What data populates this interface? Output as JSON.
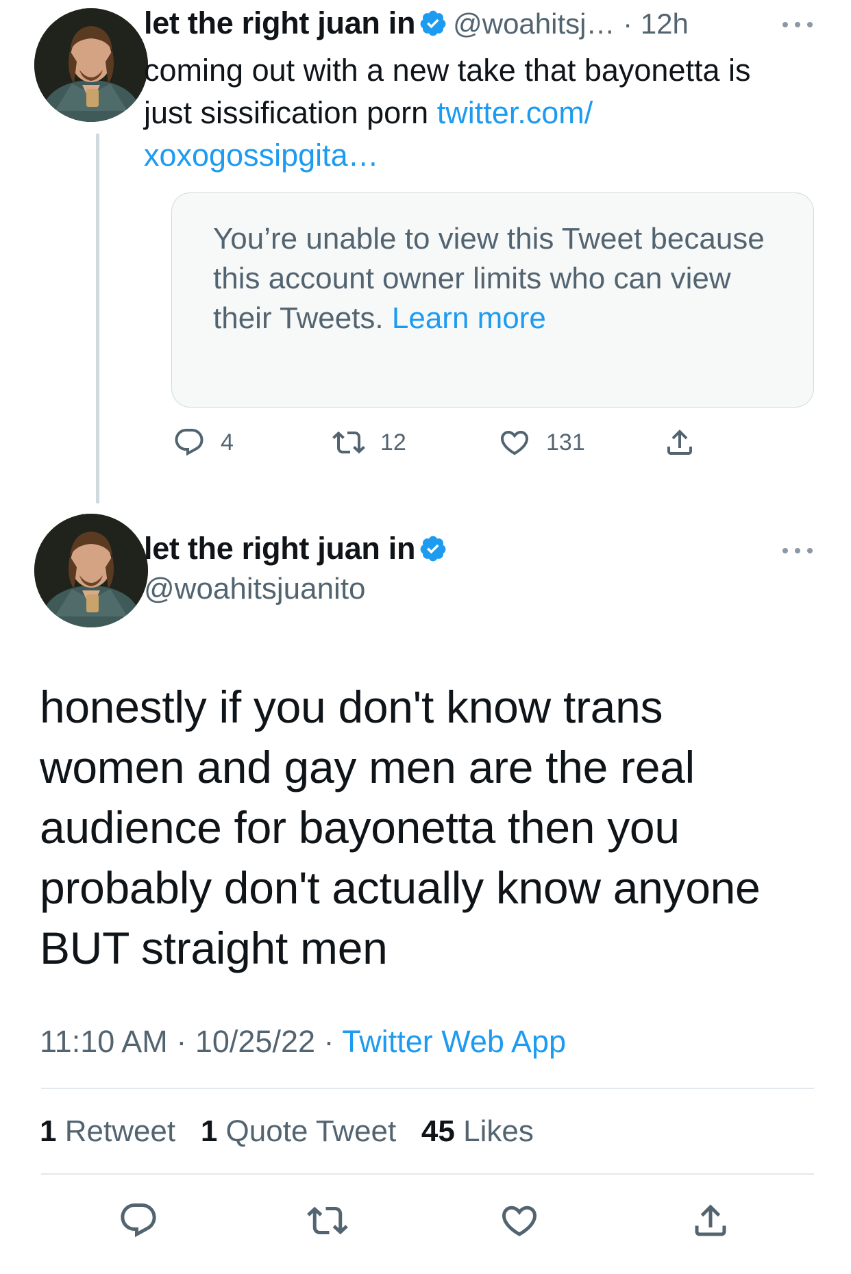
{
  "colors": {
    "accent": "#1d9bf0",
    "muted_text": "#536471",
    "primary_text": "#0f1419",
    "border": "#cfd9de",
    "quote_bg": "#f7f9f9"
  },
  "reply_tweet": {
    "author_name": "let the right juan in",
    "verified": true,
    "handle": "@woahitsj…",
    "separator": "·",
    "time": "12h",
    "more_icon": "more-horizontal-icon",
    "text_plain": "coming out with a new take that bayonetta is just sissification porn",
    "link_part1": "twitter.com/",
    "link_part2": "xoxogossipgita…",
    "quote_notice": {
      "text": "You’re unable to view this Tweet because this account owner limits who can view their Tweets.",
      "learn_more": "Learn more"
    },
    "actions": {
      "reply_count": "4",
      "retweet_count": "12",
      "like_count": "131"
    }
  },
  "main_tweet": {
    "author_name": "let the right juan in",
    "verified": true,
    "handle": "@woahitsjuanito",
    "more_icon": "more-horizontal-icon",
    "text": "honestly if you don't know trans women and gay men are the real audience for bayonetta then you probably don't actually know anyone BUT straight men",
    "time": "11:10 AM",
    "separator": "·",
    "date": "10/25/22",
    "source": "Twitter Web App",
    "stats": {
      "retweets_count": "1",
      "retweets_label": "Retweet",
      "quotes_count": "1",
      "quotes_label": "Quote Tweet",
      "likes_count": "45",
      "likes_label": "Likes"
    }
  }
}
